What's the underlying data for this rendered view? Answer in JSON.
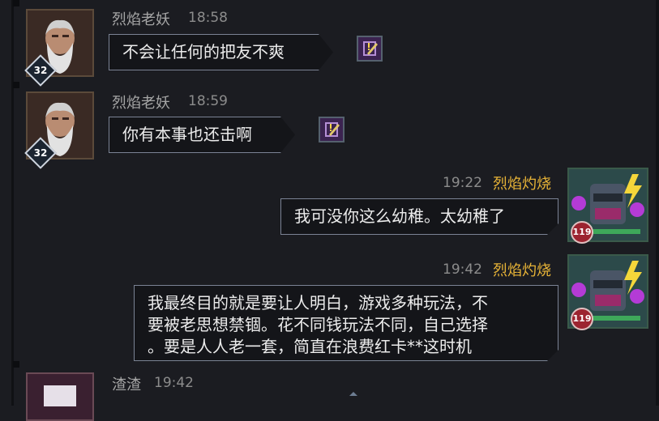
{
  "messages": [
    {
      "sender": "烈焰老妖",
      "time": "18:58",
      "text": "不会让任何的把友不爽",
      "level": "32"
    },
    {
      "sender": "烈焰老妖",
      "time": "18:59",
      "text": "你有本事也还击啊",
      "level": "32"
    },
    {
      "sender": "烈焰灼烧",
      "time": "19:22",
      "text": "我可没你这么幼稚。太幼稚了",
      "level": "119"
    },
    {
      "sender": "烈焰灼烧",
      "time": "19:42",
      "text_lines": [
        "我最终目的就是要让人明白，游戏多种玩法，不",
        "要被老思想禁锢。花不同钱玩法不同，自己选择",
        "。要是人人老一套，简直在浪费红卡**这时机"
      ],
      "level": "119"
    },
    {
      "sender": "渣渣",
      "time": "19:42"
    }
  ],
  "colors": {
    "self_name": "#e8b437",
    "other_name": "#a6a6a6",
    "bubble_border": "#7b8394"
  }
}
